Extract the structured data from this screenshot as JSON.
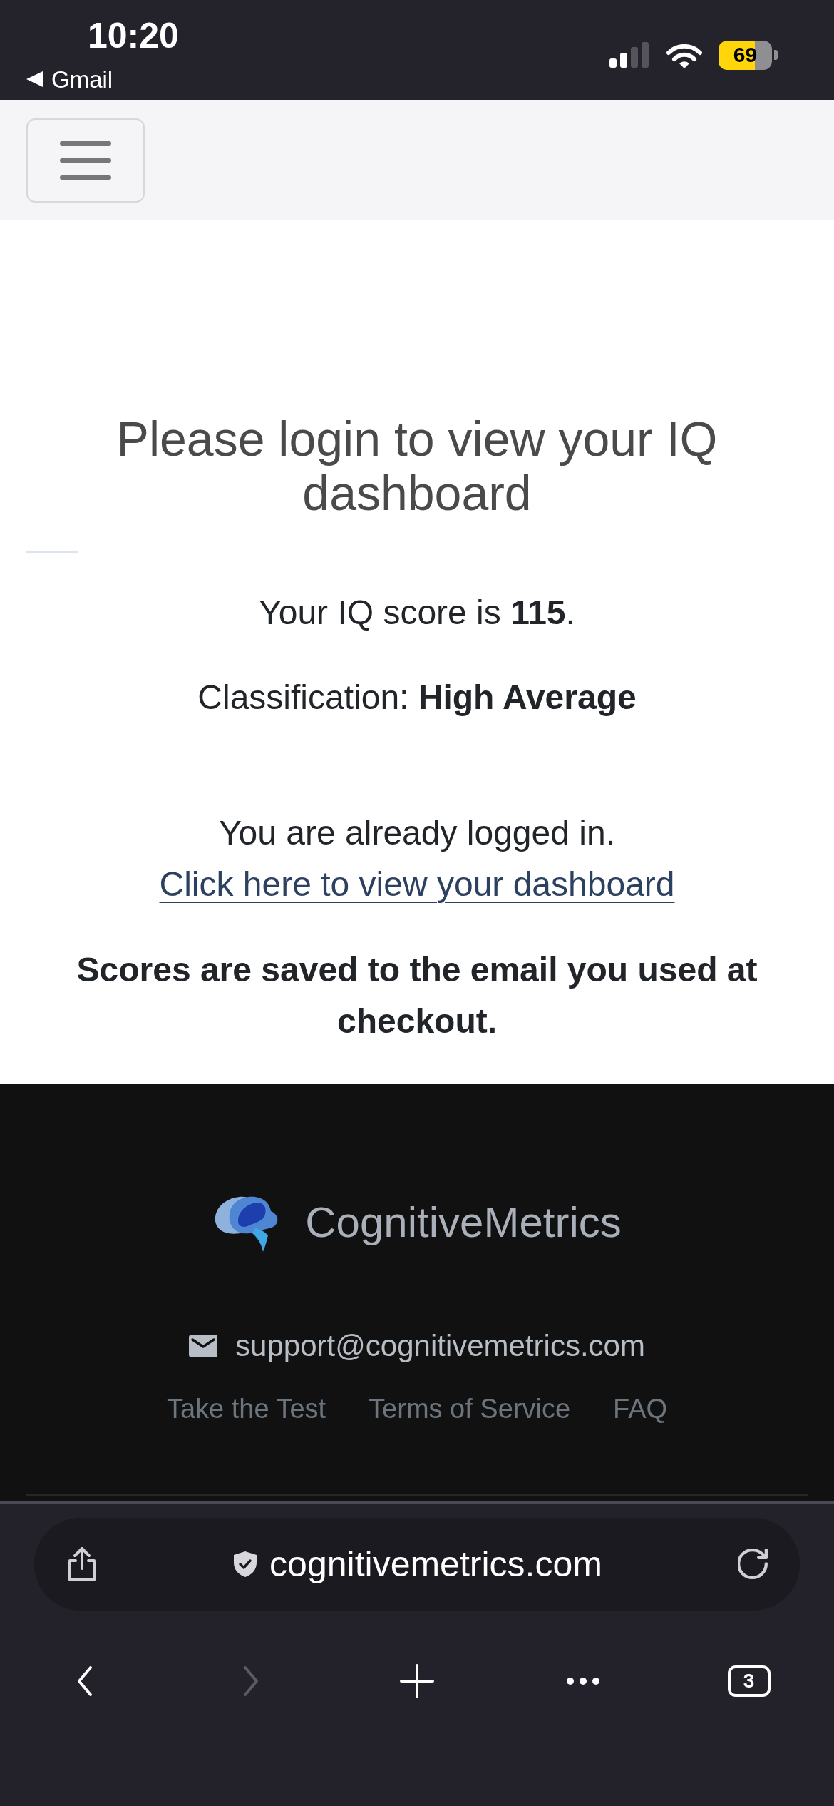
{
  "status_bar": {
    "time": "10:20",
    "back_app": "Gmail",
    "battery": "69"
  },
  "main": {
    "heading": "Please login to view your IQ dashboard",
    "score": "Your IQ score is **115**.",
    "classification": "Classification: **High Average**",
    "login_notice": {
      "text": "You are already logged in.",
      "link": "Click here to view your dashboard"
    },
    "note": "Scores are saved to the email you used at checkout."
  },
  "footer": {
    "brand": "CognitiveMetrics",
    "email": "support@cognitivemetrics.com",
    "links": [
      "Take the Test",
      "Terms of Service",
      "FAQ"
    ]
  },
  "browser": {
    "url": "cognitivemetrics.com",
    "toolbar": [
      {
        "kind": "back",
        "disabled": false
      },
      {
        "kind": "forward",
        "disabled": true
      },
      {
        "kind": "new_tab",
        "disabled": false
      },
      {
        "kind": "more",
        "disabled": false
      },
      {
        "kind": "tabs",
        "disabled": false,
        "count": "3"
      }
    ]
  }
}
